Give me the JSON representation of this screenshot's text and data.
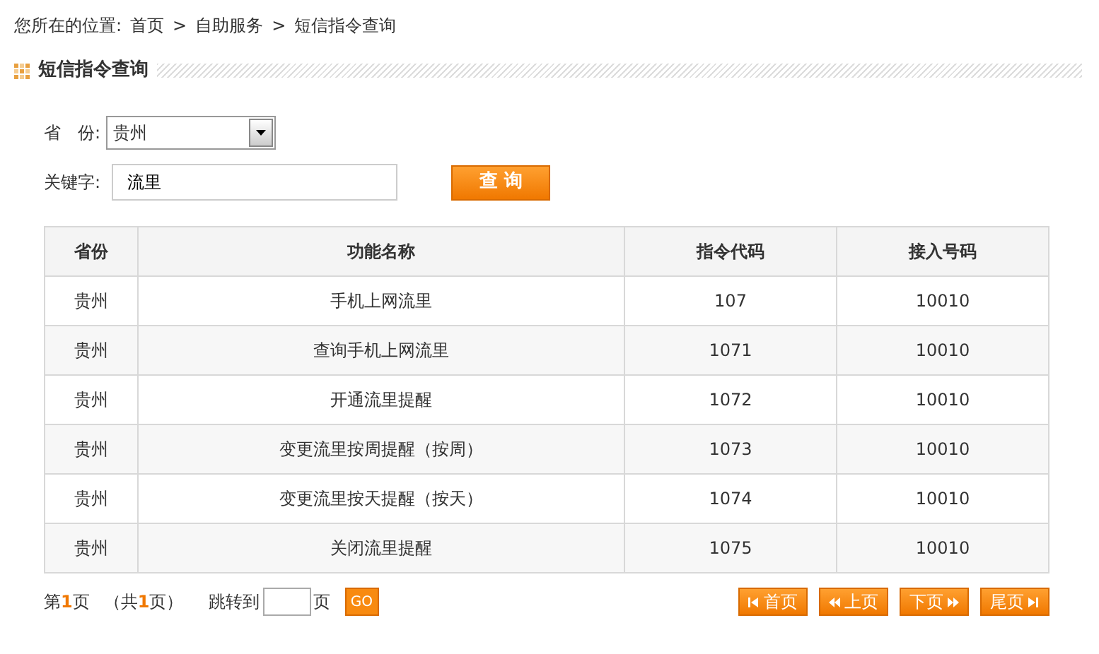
{
  "breadcrumb": {
    "prefix": "您所在的位置:",
    "items": [
      {
        "label": "首页"
      },
      {
        "label": "自助服务"
      },
      {
        "label": "短信指令查询"
      }
    ],
    "separator": ">"
  },
  "section_title": "短信指令查询",
  "form": {
    "province": {
      "label": "省　份:",
      "value": "贵州"
    },
    "keyword": {
      "label": "关键字:",
      "value": "流里"
    },
    "submit": "查 询"
  },
  "table": {
    "columns": [
      "省份",
      "功能名称",
      "指令代码",
      "接入号码"
    ],
    "rows": [
      [
        "贵州",
        "手机上网流里",
        "107",
        "10010"
      ],
      [
        "贵州",
        "查询手机上网流里",
        "1071",
        "10010"
      ],
      [
        "贵州",
        "开通流里提醒",
        "1072",
        "10010"
      ],
      [
        "贵州",
        "变更流里按周提醒（按周）",
        "1073",
        "10010"
      ],
      [
        "贵州",
        "变更流里按天提醒（按天）",
        "1074",
        "10010"
      ],
      [
        "贵州",
        "关闭流里提醒",
        "1075",
        "10010"
      ]
    ]
  },
  "pager": {
    "current": {
      "before": "第",
      "number": "1",
      "after": "页"
    },
    "total": {
      "before": "（共",
      "number": "1",
      "after": "页）"
    },
    "jump_label": "跳转到",
    "jump_suffix": "页",
    "go": "GO",
    "buttons": [
      {
        "kind": "first",
        "label": "首页"
      },
      {
        "kind": "prev",
        "label": "上页"
      },
      {
        "kind": "next",
        "label": "下页"
      },
      {
        "kind": "last",
        "label": "尾页"
      }
    ]
  }
}
